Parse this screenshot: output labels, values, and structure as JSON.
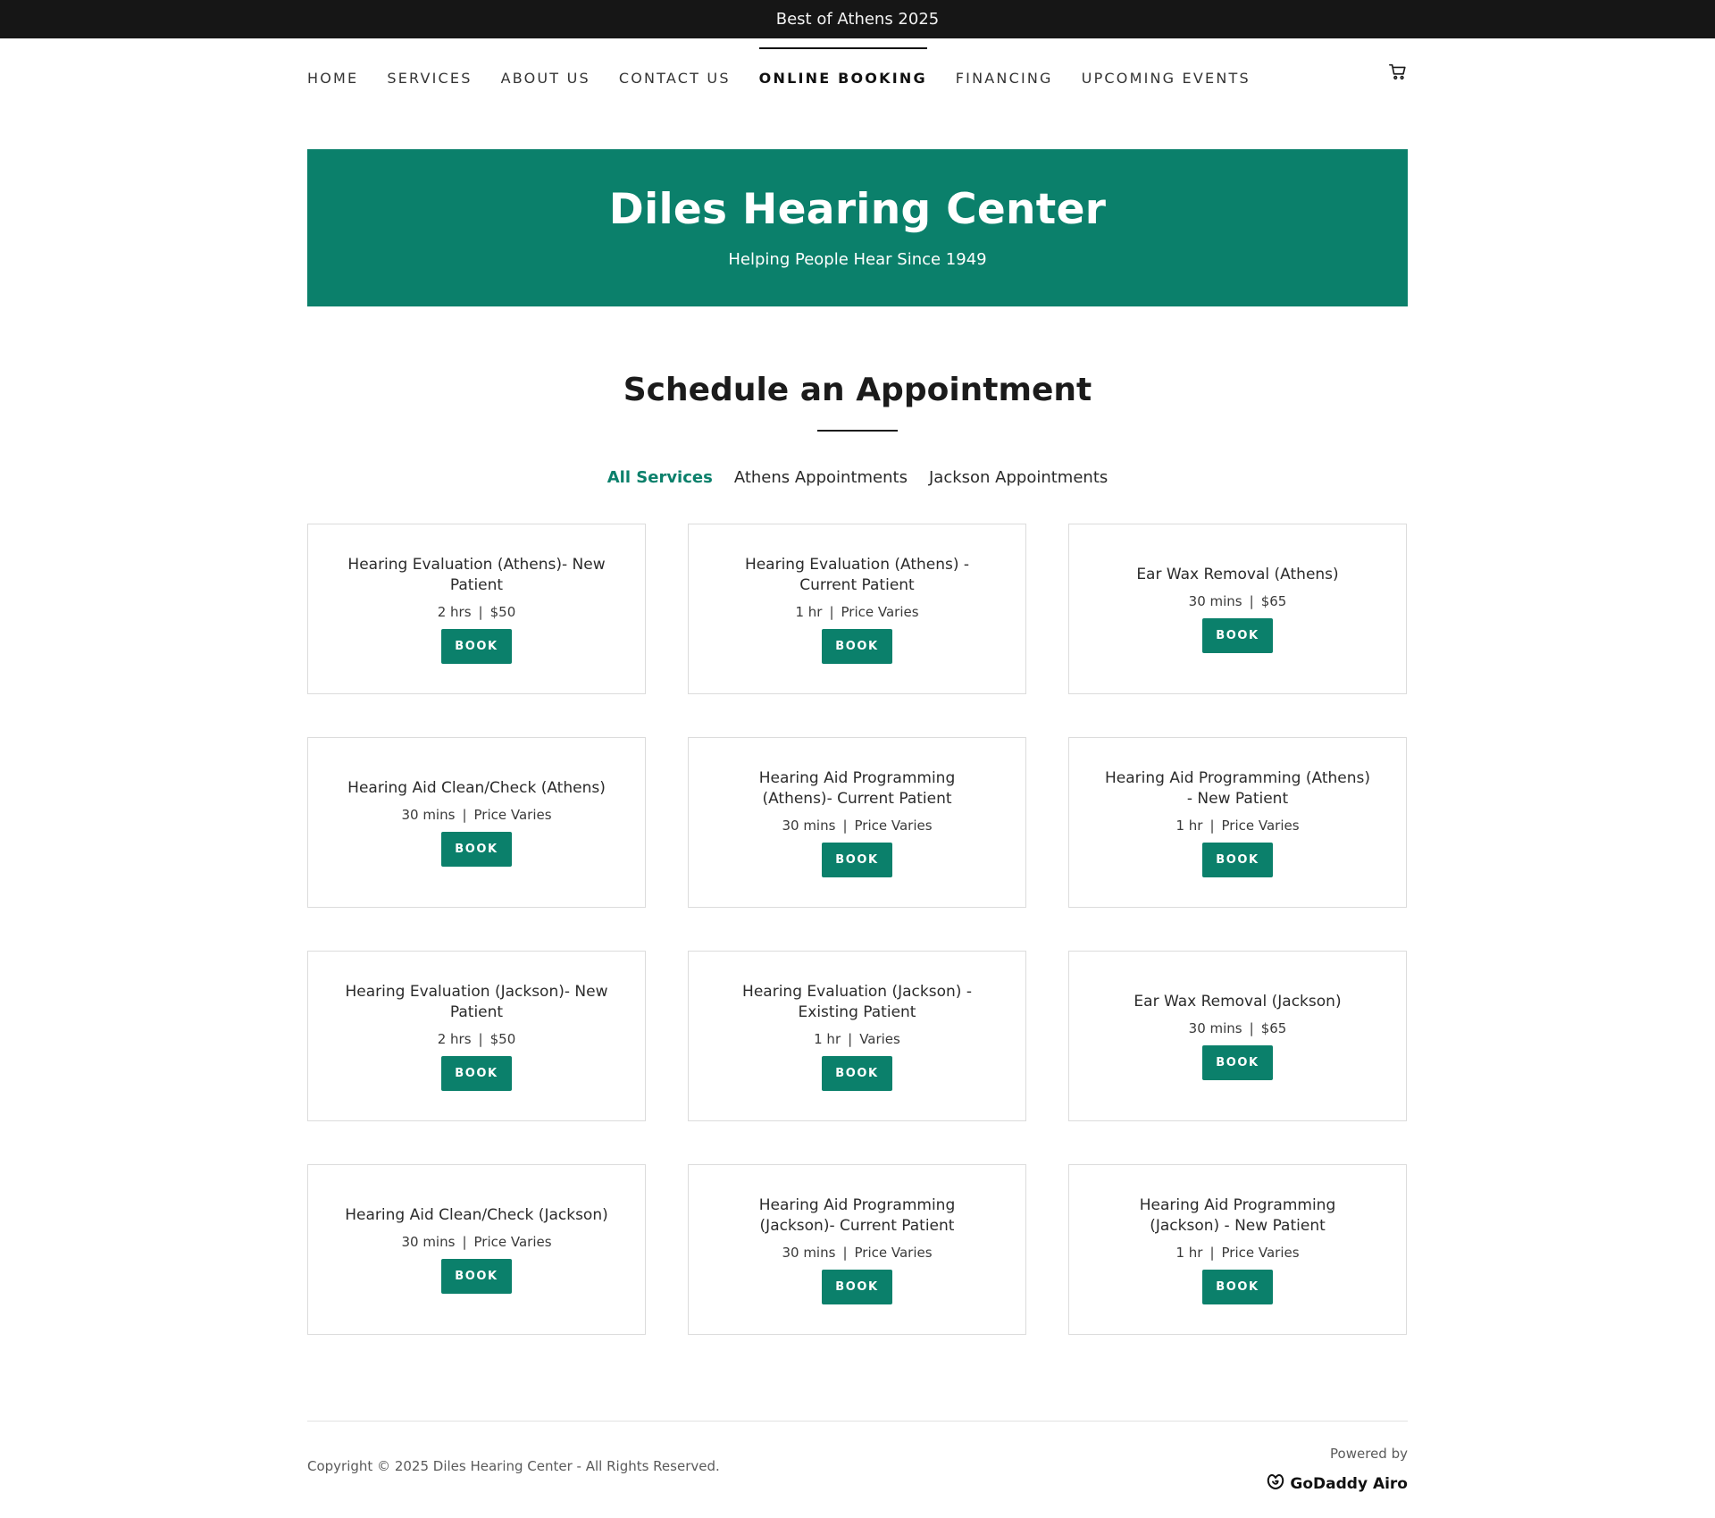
{
  "announcement": "Best of Athens 2025",
  "nav": {
    "items": [
      {
        "label": "HOME",
        "active": false
      },
      {
        "label": "SERVICES",
        "active": false
      },
      {
        "label": "ABOUT US",
        "active": false
      },
      {
        "label": "CONTACT US",
        "active": false
      },
      {
        "label": "ONLINE BOOKING",
        "active": true
      },
      {
        "label": "FINANCING",
        "active": false
      },
      {
        "label": "UPCOMING EVENTS",
        "active": false
      }
    ],
    "cart_icon": "cart-icon"
  },
  "hero": {
    "title": "Diles Hearing Center",
    "subtitle": "Helping People Hear Since 1949",
    "background_color": "#0b806b"
  },
  "section": {
    "title": "Schedule an Appointment"
  },
  "tabs": [
    {
      "label": "All Services",
      "active": true
    },
    {
      "label": "Athens Appointments",
      "active": false
    },
    {
      "label": "Jackson Appointments",
      "active": false
    }
  ],
  "services": [
    {
      "title": "Hearing Evaluation (Athens)- New Patient",
      "duration": "2 hrs",
      "price": "$50",
      "button": "BOOK"
    },
    {
      "title": "Hearing Evaluation (Athens) - Current Patient",
      "duration": "1 hr",
      "price": "Price Varies",
      "button": "BOOK"
    },
    {
      "title": "Ear Wax Removal (Athens)",
      "duration": "30 mins",
      "price": "$65",
      "button": "BOOK"
    },
    {
      "title": "Hearing Aid Clean/Check (Athens)",
      "duration": "30 mins",
      "price": "Price Varies",
      "button": "BOOK"
    },
    {
      "title": "Hearing Aid Programming (Athens)- Current Patient",
      "duration": "30 mins",
      "price": "Price Varies",
      "button": "BOOK"
    },
    {
      "title": "Hearing Aid Programming (Athens) - New Patient",
      "duration": "1 hr",
      "price": "Price Varies",
      "button": "BOOK"
    },
    {
      "title": "Hearing Evaluation (Jackson)- New Patient",
      "duration": "2 hrs",
      "price": "$50",
      "button": "BOOK"
    },
    {
      "title": "Hearing Evaluation (Jackson) - Existing Patient",
      "duration": "1 hr",
      "price": "Varies",
      "button": "BOOK"
    },
    {
      "title": "Ear Wax Removal (Jackson)",
      "duration": "30 mins",
      "price": "$65",
      "button": "BOOK"
    },
    {
      "title": "Hearing Aid Clean/Check (Jackson)",
      "duration": "30 mins",
      "price": "Price Varies",
      "button": "BOOK"
    },
    {
      "title": "Hearing Aid Programming (Jackson)- Current Patient",
      "duration": "30 mins",
      "price": "Price Varies",
      "button": "BOOK"
    },
    {
      "title": "Hearing Aid Programming (Jackson) - New Patient",
      "duration": "1 hr",
      "price": "Price Varies",
      "button": "BOOK"
    }
  ],
  "footer": {
    "copyright": "Copyright © 2025 Diles Hearing Center - All Rights Reserved.",
    "powered_by": "Powered by",
    "brand": "GoDaddy Airo",
    "brand_icon": "godaddy-logo-icon"
  },
  "colors": {
    "accent": "#0b806b",
    "announcement_bar": "#161616"
  }
}
